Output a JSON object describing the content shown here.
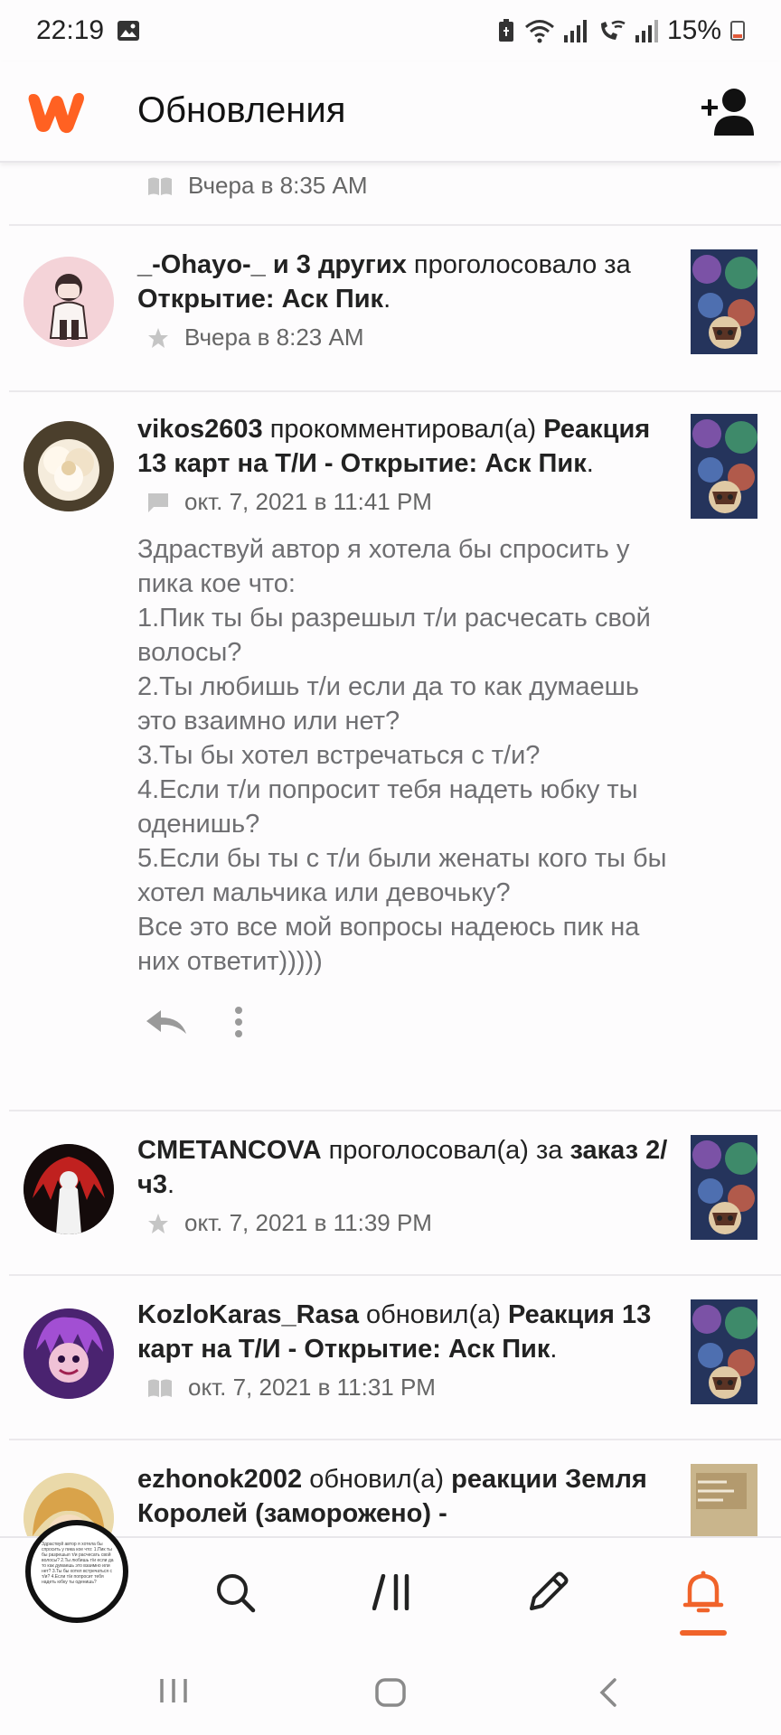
{
  "status": {
    "time": "22:19",
    "battery": "15%",
    "icons": [
      "image-icon",
      "saver-icon",
      "wifi-icon",
      "signal-icon",
      "wifi-call-icon",
      "signal-icon",
      "battery-icon"
    ]
  },
  "header": {
    "title": "Обновления",
    "logo": "wattpad-logo",
    "action_icon": "add-friend-icon"
  },
  "feed": {
    "top_meta": "Вчера в 8:35 AM",
    "items": [
      {
        "user": "_-Ohayo-_ и 3 других",
        "action": " проголосовало за ",
        "target": "Открытие: Аск Пик",
        "end": ".",
        "meta": "Вчера в 8:23 AM",
        "meta_icon": "star-icon"
      },
      {
        "user": "vikos2603",
        "action": " прокомментировал(а) ",
        "target": "Реакция 13 карт на Т/И - Открытие: Аск Пик",
        "end": ".",
        "meta": "окт. 7, 2021 в 11:41 PM",
        "meta_icon": "comment-icon",
        "comment": [
          "Здраствуй автор я хотела бы спросить у пика кое что:",
          "1.Пик ты бы разрешыл т/и расчесать свой волосы?",
          "2.Ты любишь т/и если да то как думаешь это взаимно или нет?",
          "3.Ты бы хотел встречаться с т/и?",
          "4.Если т/и попросит тебя надеть юбку ты оденишь?",
          "5.Если бы ты с т/и были женаты кого ты бы хотел мальчика или девочьку?",
          "Все это все мой вопросы надеюсь пик на них ответит)))))"
        ]
      },
      {
        "user": "CMETANCOVA",
        "action": " проголосовал(а) за ",
        "target": "заказ 2/ч3",
        "end": ".",
        "meta": "окт. 7, 2021 в 11:39 PM",
        "meta_icon": "star-icon"
      },
      {
        "user": "KozloKaras_Rasa",
        "action": " обновил(а) ",
        "target": "Реакция 13 карт на Т/И - Открытие: Аск Пик",
        "end": ".",
        "meta": "окт. 7, 2021 в 11:31 PM",
        "meta_icon": "book-icon"
      },
      {
        "user": "ezhonok2002",
        "action": " обновил(а) ",
        "target": "реакции Земля Королей (заморожено) -",
        "end": ""
      }
    ]
  },
  "bottom_nav": {
    "items": [
      "home-icon",
      "search-icon",
      "library-icon",
      "write-icon",
      "notifications-icon"
    ],
    "active": "notifications-icon",
    "active_color": "#f0632a"
  },
  "bubble_preview": "Здраствуй автор я хотела бы спросить у пика кое что: 1.Пик ты бы разрешыл т/и расчесать свой волосы? 2.Ты любишь т/и если да то как думаешь это взаимно или нет? 3.Ты бы хотел встречаться с т/и? 4.Если т/и попросит тебя надеть юбку ты оденишь?",
  "colors": {
    "brand": "#ff6122",
    "accent": "#f0632a",
    "text": "#222222",
    "muted": "#666666"
  }
}
